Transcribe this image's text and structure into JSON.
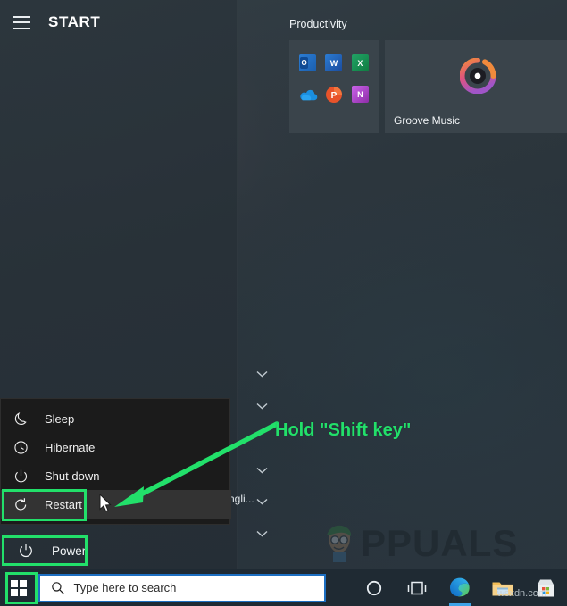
{
  "start_menu": {
    "hamburger_icon": "hamburger-menu-icon",
    "title": "START",
    "tiles": {
      "group_label": "Productivity",
      "items": [
        {
          "name": "office-tile-group",
          "label": "",
          "icons": [
            "outlook-icon",
            "word-icon",
            "excel-icon",
            "onedrive-icon",
            "powerpoint-icon",
            "onenote-icon"
          ]
        },
        {
          "name": "groove-music-tile",
          "label": "Groove Music",
          "icons": [
            "groove-music-icon"
          ]
        }
      ]
    },
    "app_list_partial_text": "ngli...",
    "chevron_icon": "chevron-down-icon"
  },
  "power_menu": {
    "items": [
      {
        "label": "Sleep",
        "icon": "moon-icon"
      },
      {
        "label": "Hibernate",
        "icon": "clock-icon"
      },
      {
        "label": "Shut down",
        "icon": "power-icon"
      },
      {
        "label": "Restart",
        "icon": "restart-icon"
      }
    ],
    "highlighted_item": "Restart"
  },
  "power_button": {
    "label": "Power",
    "icon": "power-icon"
  },
  "annotations": {
    "callout_text": "Hold \"Shift key\"",
    "accent_color": "#22e06a",
    "arrow": "green-arrow-pointing-left-down",
    "highlight_boxes": [
      "Restart",
      "Power",
      "Start button"
    ]
  },
  "taskbar": {
    "start_button_icon": "windows-logo-icon",
    "search": {
      "icon": "search-icon",
      "placeholder": "Type here to search",
      "value": ""
    },
    "icons": [
      {
        "name": "cortana-icon",
        "label": "Cortana"
      },
      {
        "name": "task-view-icon",
        "label": "Task View"
      },
      {
        "name": "microsoft-edge-icon",
        "label": "Microsoft Edge"
      },
      {
        "name": "file-explorer-icon",
        "label": "File Explorer"
      },
      {
        "name": "microsoft-store-icon",
        "label": "Microsoft Store"
      }
    ]
  },
  "watermarks": {
    "appuals": "PPUALS",
    "wsxdn": "wsxdn.com"
  }
}
